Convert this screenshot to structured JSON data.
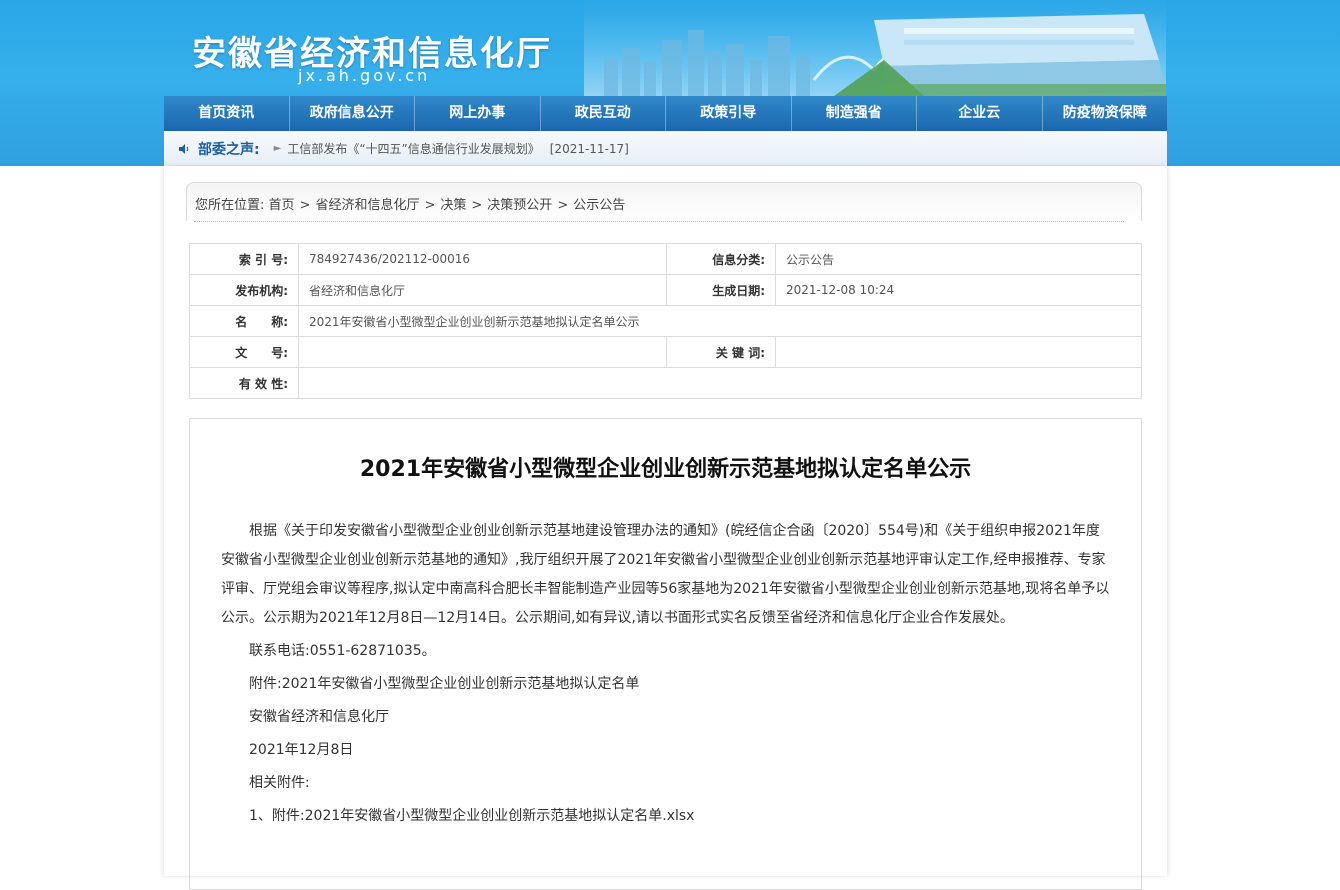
{
  "header": {
    "title": "安徽省经济和信息化厅",
    "domain": "jx.ah.gov.cn"
  },
  "nav": {
    "items": [
      "首页资讯",
      "政府信息公开",
      "网上办事",
      "政民互动",
      "政策引导",
      "制造强省",
      "企业云",
      "防疫物资保障"
    ]
  },
  "voice": {
    "label": "部委之声:",
    "text": "工信部发布《“十四五”信息通信行业发展规划》",
    "date": "[2021-11-17]"
  },
  "breadcrumb": {
    "prefix": "您所在位置:",
    "items": [
      "首页",
      "省经济和信息化厅",
      "决策",
      "决策预公开",
      "公示公告"
    ],
    "separator": ">"
  },
  "meta": {
    "index_label": "索 引 号:",
    "index_value": "784927436/202112-00016",
    "category_label": "信息分类:",
    "category_value": "公示公告",
    "publisher_label": "发布机构:",
    "publisher_value": "省经济和信息化厅",
    "date_label": "生成日期:",
    "date_value": "2021-12-08 10:24",
    "name_label": "名　　称:",
    "name_value": "2021年安徽省小型微型企业创业创新示范基地拟认定名单公示",
    "docno_label": "文　　号:",
    "docno_value": "",
    "keywords_label": "关 键 词:",
    "keywords_value": "",
    "validity_label": "有 效 性:",
    "validity_value": ""
  },
  "article": {
    "title": "2021年安徽省小型微型企业创业创新示范基地拟认定名单公示",
    "paragraph1": "根据《关于印发安徽省小型微型企业创业创新示范基地建设管理办法的通知》(皖经信企合函〔2020〕554号)和《关于组织申报2021年度安徽省小型微型企业创业创新示范基地的通知》,我厅组织开展了2021年安徽省小型微型企业创业创新示范基地评审认定工作,经申报推荐、专家评审、厅党组会审议等程序,拟认定中南高科合肥长丰智能制造产业园等56家基地为2021年安徽省小型微型企业创业创新示范基地,现将名单予以公示。公示期为2021年12月8日—12月14日。公示期间,如有异议,请以书面形式实名反馈至省经济和信息化厅企业合作发展处。",
    "phone": "联系电话:0551-62871035。",
    "attachment_note": "附件:2021年安徽省小型微型企业创业创新示范基地拟认定名单",
    "signer": "安徽省经济和信息化厅",
    "sign_date": "2021年12月8日",
    "related_label": "相关附件:",
    "related_file": "1、附件:2021年安徽省小型微型企业创业创新示范基地拟认定名单.xlsx"
  }
}
